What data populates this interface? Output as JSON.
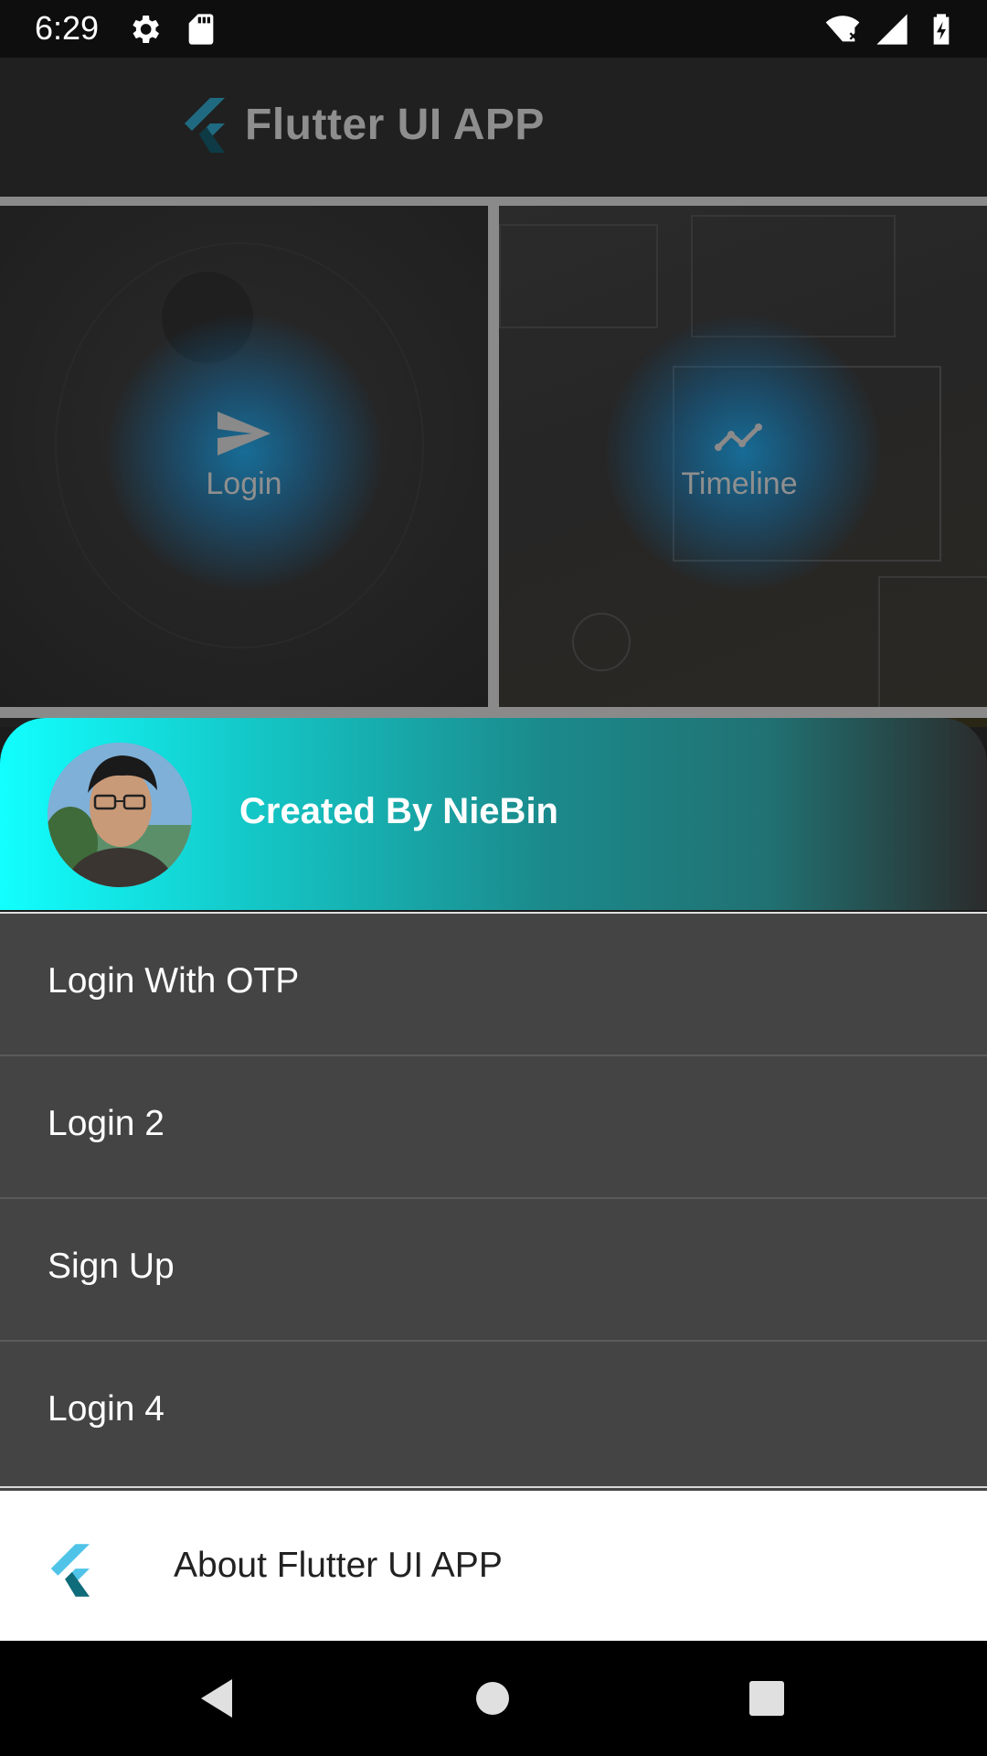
{
  "status_bar": {
    "time": "6:29",
    "icons": [
      "gear-icon",
      "sd-card-icon",
      "wifi-icon",
      "signal-icon",
      "battery-icon"
    ]
  },
  "app_bar": {
    "title": "Flutter UI APP",
    "logo_icon": "flutter-logo-icon"
  },
  "grid": {
    "tiles": [
      {
        "label": "Login",
        "icon": "send-icon"
      },
      {
        "label": "Timeline",
        "icon": "timeline-icon"
      }
    ]
  },
  "drawer": {
    "header": {
      "title": "Created By NieBin",
      "avatar": "profile-avatar"
    },
    "menu": [
      {
        "label": "Login With OTP"
      },
      {
        "label": "Login 2"
      },
      {
        "label": "Sign Up"
      },
      {
        "label": "Login 4"
      }
    ],
    "about": {
      "label": "About Flutter UI APP",
      "icon": "flutter-logo-icon"
    }
  },
  "colors": {
    "accent_cyan": "#12ffff",
    "teal": "#217172",
    "menu_bg": "#444444",
    "glow_blue": "#1478aa"
  },
  "nav_bar": {
    "buttons": [
      "back-icon",
      "home-icon",
      "recents-icon"
    ]
  }
}
